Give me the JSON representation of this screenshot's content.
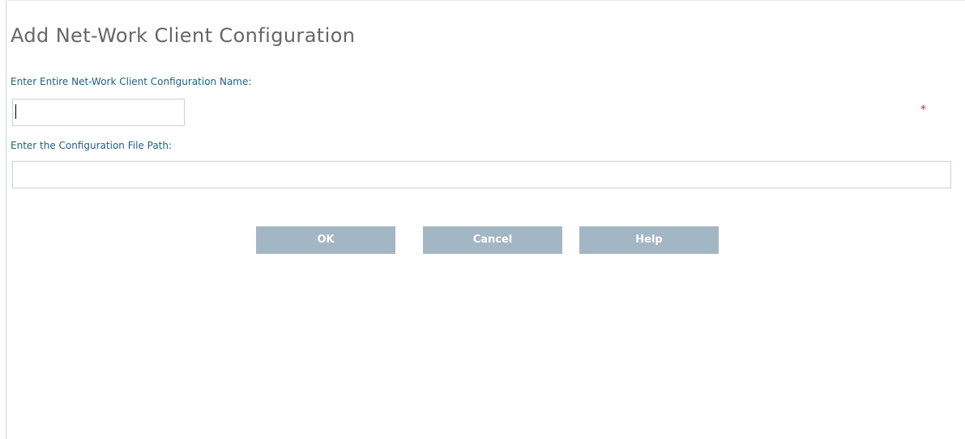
{
  "page": {
    "title": "Add Net-Work Client Configuration"
  },
  "form": {
    "name_label": "Enter Entire Net-Work Client Configuration Name:",
    "name_value": "",
    "required_marker": "*",
    "path_label": "Enter the Configuration File Path:",
    "path_value": ""
  },
  "actions": {
    "ok_label": "OK",
    "cancel_label": "Cancel",
    "help_label": "Help"
  },
  "colors": {
    "label_text": "#1f5f86",
    "title_text": "#666666",
    "required": "#e3262d",
    "button_bg": "#a3b6c4",
    "button_text": "#ffffff"
  }
}
